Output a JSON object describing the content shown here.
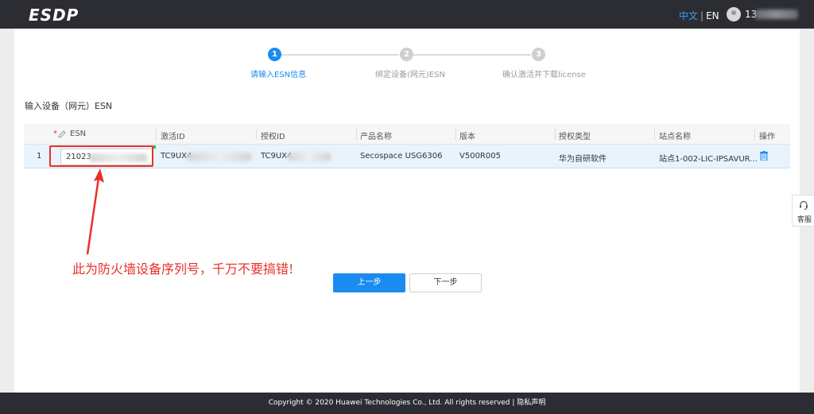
{
  "header": {
    "logo": "ESDP",
    "lang_zh": "中文",
    "lang_sep": "|",
    "lang_en": "EN",
    "username": "13"
  },
  "steps": [
    {
      "number": "1",
      "label": "请输入ESN信息",
      "active": true
    },
    {
      "number": "2",
      "label": "绑定设备(网元)ESN",
      "active": false
    },
    {
      "number": "3",
      "label": "确认激活并下载license",
      "active": false
    }
  ],
  "section_title": "输入设备（网元）ESN",
  "table": {
    "headers": {
      "esn": "ESN",
      "activation_id": "激活ID",
      "auth_id": "授权ID",
      "product_name": "产品名称",
      "version": "版本",
      "auth_type": "授权类型",
      "site_name": "站点名称",
      "action": "操作"
    },
    "required_mark": "*",
    "rows": [
      {
        "index": "1",
        "esn": "21023",
        "activation_id": "TC9UX4",
        "auth_id": "TC9UX4",
        "product_name": "Secospace USG6306",
        "version": "V500R005",
        "auth_type": "华为自研软件",
        "site_name": "站点1-002-LIC-IPSAVUR..."
      }
    ]
  },
  "annotation": "此为防火墙设备序列号，千万不要搞错!",
  "buttons": {
    "prev": "上一步",
    "next": "下一步"
  },
  "service": {
    "label": "客服"
  },
  "footer": {
    "copyright": "Copyright © 2020 Huawei Technologies Co., Ltd. All rights reserved |",
    "privacy": "隐私声明"
  },
  "colors": {
    "accent": "#1a8cf0",
    "annotation_red": "#e8302a",
    "header_bg": "#2b2d33"
  }
}
